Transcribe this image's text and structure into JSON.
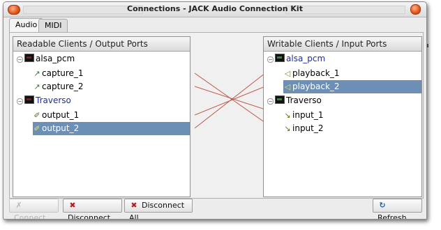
{
  "window": {
    "title": "Connections - JACK Audio Connection Kit"
  },
  "tabs": [
    {
      "label": "Audio",
      "active": true
    },
    {
      "label": "MIDI",
      "active": false
    }
  ],
  "output_panel": {
    "header": "Readable Clients / Output Ports",
    "clients": [
      {
        "name": "alsa_pcm",
        "ports": [
          "capture_1",
          "capture_2"
        ]
      },
      {
        "name": "Traverso",
        "ports": [
          "output_1",
          "output_2"
        ]
      }
    ],
    "selected_port": "output_2"
  },
  "input_panel": {
    "header": "Writable Clients / Input Ports",
    "clients": [
      {
        "name": "alsa_pcm",
        "ports": [
          "playback_1",
          "playback_2"
        ]
      },
      {
        "name": "Traverso",
        "ports": [
          "input_1",
          "input_2"
        ]
      }
    ],
    "selected_port": "playback_2"
  },
  "connections": [
    {
      "from": "capture_1",
      "to": "input_2"
    },
    {
      "from": "capture_2",
      "to": "input_1"
    },
    {
      "from": "output_1",
      "to": "playback_2"
    },
    {
      "from": "output_2",
      "to": "playback_1"
    }
  ],
  "buttons": {
    "connect": "Connect",
    "disconnect": "Disconnect",
    "disconnect_all": "Disconnect All",
    "refresh": "Refresh"
  },
  "colors": {
    "selection": "#6d8fb6",
    "link": "#1c2d9b",
    "connection_line": "#c0564a"
  },
  "icons": {
    "toggle": "minus-toggle-icon",
    "client": "client-app-icon",
    "capture": "microphone-icon",
    "output": "plug-icon",
    "playback": "speaker-icon",
    "input": "plug-icon"
  }
}
